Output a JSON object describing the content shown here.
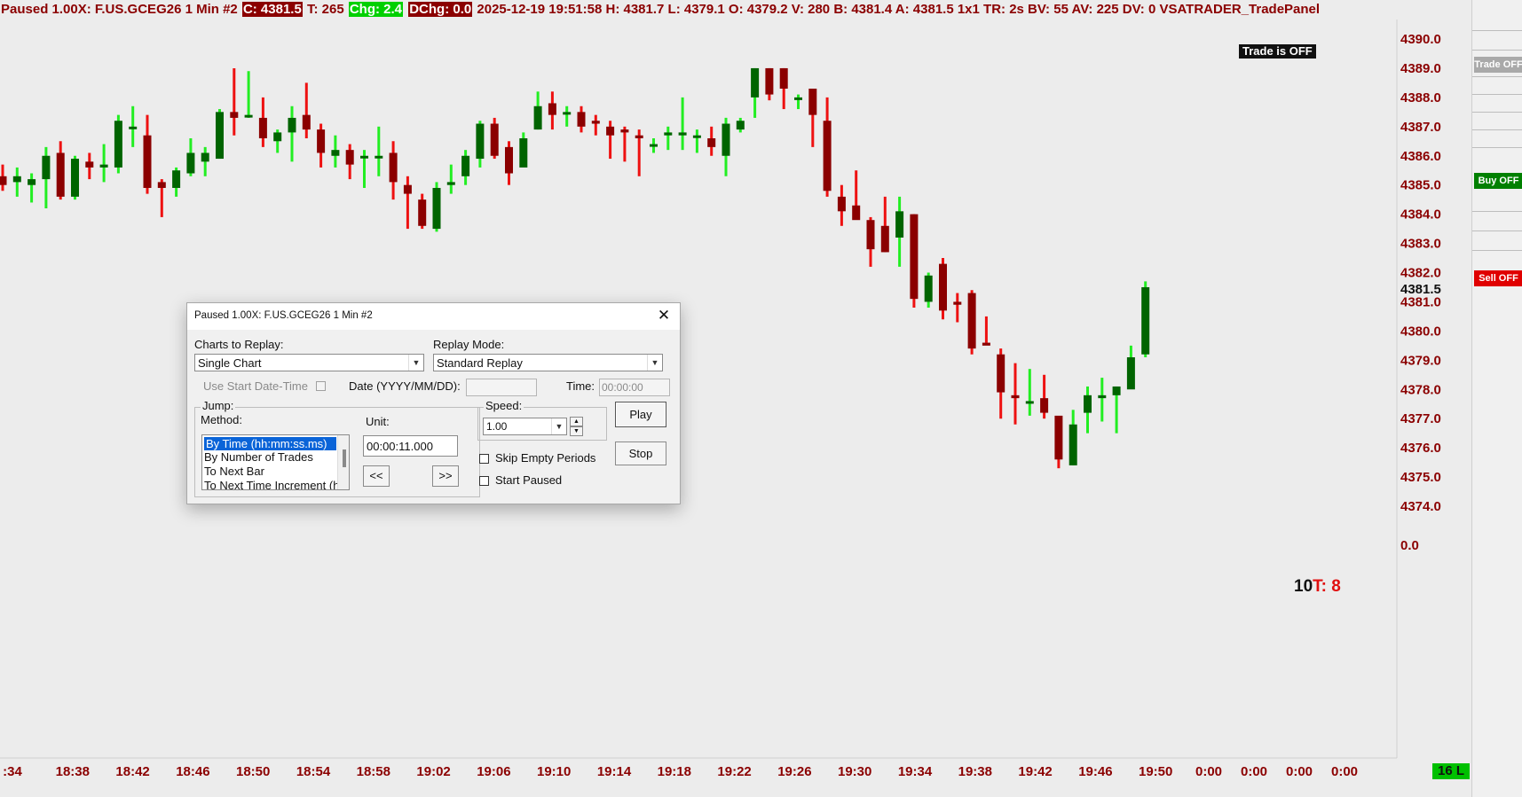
{
  "header": {
    "segments": [
      {
        "text": "Paused 1.00X: F.US.GCEG26  1 Min  #2 ",
        "style": "plain"
      },
      {
        "text": "C: 4381.5",
        "style": "dark"
      },
      {
        "text": " T: 265 ",
        "style": "plain"
      },
      {
        "text": "Chg: 2.4",
        "style": "green"
      },
      {
        "text": " ",
        "style": "plain"
      },
      {
        "text": "DChg: 0.0",
        "style": "dark"
      },
      {
        "text": " 2025-12-19 19:51:58 H: 4381.7 L: 4379.1 O: 4379.2 V: 280 B: 4381.4 A: 4381.5 1x1 TR: 2s BV: 55 AV: 225 DV: 0 VSATRADER_TradePanel",
        "style": "plain"
      }
    ]
  },
  "trade_off_label": "Trade is OFF",
  "right_panel": {
    "trade_off": "Trade OFF",
    "buy_off": "Buy OFF",
    "sell_off": "Sell OFF",
    "colors": {
      "trade": "#a9a9a9",
      "buy": "#008000",
      "sell": "#e00000"
    }
  },
  "bar_timer": {
    "part1": "10",
    "part2": "T: 8"
  },
  "bottom_badge": "16 L",
  "chart_data": {
    "type": "candlestick",
    "price_axis": {
      "labels": [
        "4390.0",
        "4389.0",
        "4388.0",
        "4387.0",
        "4386.0",
        "4385.0",
        "4384.0",
        "4383.0",
        "4382.0",
        "4381.0",
        "4380.0",
        "4379.0",
        "4378.0",
        "4377.0",
        "4376.0",
        "4375.0",
        "4374.0"
      ],
      "current_price": "4381.5",
      "extra_label": "0.0",
      "range": [
        4374.0,
        4390.0
      ]
    },
    "time_axis": {
      "labels": [
        ":34",
        "18:38",
        "18:42",
        "18:46",
        "18:50",
        "18:54",
        "18:58",
        "19:02",
        "19:06",
        "19:10",
        "19:14",
        "19:18",
        "19:22",
        "19:26",
        "19:30",
        "19:34",
        "19:38",
        "19:42",
        "19:46",
        "19:50",
        "0:00",
        "0:00",
        "0:00",
        "0:00"
      ]
    },
    "colors": {
      "up": "#00c800",
      "down": "#d40000",
      "up_body": "#006400",
      "down_body": "#8b0000",
      "up_wick": "#22ee22",
      "down_wick": "#ee1111"
    },
    "candles": [
      {
        "o": 4385.3,
        "h": 4385.7,
        "l": 4384.8,
        "c": 4385.0
      },
      {
        "o": 4385.1,
        "h": 4385.6,
        "l": 4384.6,
        "c": 4385.3
      },
      {
        "o": 4385.0,
        "h": 4385.4,
        "l": 4384.4,
        "c": 4385.2
      },
      {
        "o": 4385.2,
        "h": 4386.3,
        "l": 4384.2,
        "c": 4386.0
      },
      {
        "o": 4386.1,
        "h": 4386.5,
        "l": 4384.5,
        "c": 4384.6
      },
      {
        "o": 4384.6,
        "h": 4386.0,
        "l": 4384.5,
        "c": 4385.9
      },
      {
        "o": 4385.8,
        "h": 4386.1,
        "l": 4385.2,
        "c": 4385.6
      },
      {
        "o": 4385.6,
        "h": 4386.4,
        "l": 4385.1,
        "c": 4385.7
      },
      {
        "o": 4385.6,
        "h": 4387.4,
        "l": 4385.4,
        "c": 4387.2
      },
      {
        "o": 4387.0,
        "h": 4387.7,
        "l": 4386.3,
        "c": 4387.0
      },
      {
        "o": 4386.7,
        "h": 4387.4,
        "l": 4384.7,
        "c": 4384.9
      },
      {
        "o": 4385.1,
        "h": 4385.2,
        "l": 4383.9,
        "c": 4384.9
      },
      {
        "o": 4384.9,
        "h": 4385.6,
        "l": 4384.6,
        "c": 4385.5
      },
      {
        "o": 4385.4,
        "h": 4386.6,
        "l": 4385.3,
        "c": 4386.1
      },
      {
        "o": 4385.8,
        "h": 4386.3,
        "l": 4385.3,
        "c": 4386.1
      },
      {
        "o": 4385.9,
        "h": 4387.6,
        "l": 4385.9,
        "c": 4387.5
      },
      {
        "o": 4387.5,
        "h": 4389.0,
        "l": 4386.7,
        "c": 4387.3
      },
      {
        "o": 4387.4,
        "h": 4388.9,
        "l": 4387.3,
        "c": 4387.4
      },
      {
        "o": 4387.3,
        "h": 4388.0,
        "l": 4386.3,
        "c": 4386.6
      },
      {
        "o": 4386.5,
        "h": 4386.9,
        "l": 4386.1,
        "c": 4386.8
      },
      {
        "o": 4386.8,
        "h": 4387.7,
        "l": 4385.8,
        "c": 4387.3
      },
      {
        "o": 4387.4,
        "h": 4388.5,
        "l": 4386.6,
        "c": 4386.9
      },
      {
        "o": 4386.9,
        "h": 4387.1,
        "l": 4385.6,
        "c": 4386.1
      },
      {
        "o": 4386.0,
        "h": 4386.7,
        "l": 4385.6,
        "c": 4386.2
      },
      {
        "o": 4386.2,
        "h": 4386.4,
        "l": 4385.2,
        "c": 4385.7
      },
      {
        "o": 4386.0,
        "h": 4386.2,
        "l": 4384.9,
        "c": 4386.0
      },
      {
        "o": 4386.0,
        "h": 4387.0,
        "l": 4385.3,
        "c": 4386.0
      },
      {
        "o": 4386.1,
        "h": 4386.5,
        "l": 4384.5,
        "c": 4385.1
      },
      {
        "o": 4385.0,
        "h": 4385.3,
        "l": 4383.5,
        "c": 4384.7
      },
      {
        "o": 4384.5,
        "h": 4384.7,
        "l": 4383.5,
        "c": 4383.6
      },
      {
        "o": 4383.5,
        "h": 4385.1,
        "l": 4383.4,
        "c": 4384.9
      },
      {
        "o": 4385.0,
        "h": 4385.7,
        "l": 4384.7,
        "c": 4385.1
      },
      {
        "o": 4385.3,
        "h": 4386.2,
        "l": 4385.0,
        "c": 4386.0
      },
      {
        "o": 4385.9,
        "h": 4387.2,
        "l": 4385.6,
        "c": 4387.1
      },
      {
        "o": 4387.1,
        "h": 4387.3,
        "l": 4385.9,
        "c": 4386.0
      },
      {
        "o": 4386.3,
        "h": 4386.5,
        "l": 4385.0,
        "c": 4385.4
      },
      {
        "o": 4385.6,
        "h": 4386.8,
        "l": 4385.7,
        "c": 4386.6
      },
      {
        "o": 4386.9,
        "h": 4388.2,
        "l": 4386.9,
        "c": 4387.7
      },
      {
        "o": 4387.8,
        "h": 4388.2,
        "l": 4386.9,
        "c": 4387.4
      },
      {
        "o": 4387.5,
        "h": 4387.7,
        "l": 4387.0,
        "c": 4387.5
      },
      {
        "o": 4387.5,
        "h": 4387.7,
        "l": 4386.8,
        "c": 4387.0
      },
      {
        "o": 4387.2,
        "h": 4387.4,
        "l": 4386.7,
        "c": 4387.1
      },
      {
        "o": 4387.0,
        "h": 4387.2,
        "l": 4385.9,
        "c": 4386.7
      },
      {
        "o": 4386.9,
        "h": 4387.0,
        "l": 4385.8,
        "c": 4386.8
      },
      {
        "o": 4386.7,
        "h": 4386.9,
        "l": 4385.3,
        "c": 4386.6
      },
      {
        "o": 4386.4,
        "h": 4386.6,
        "l": 4386.1,
        "c": 4386.4
      },
      {
        "o": 4386.7,
        "h": 4387.0,
        "l": 4386.2,
        "c": 4386.8
      },
      {
        "o": 4386.7,
        "h": 4388.0,
        "l": 4386.2,
        "c": 4386.8
      },
      {
        "o": 4386.7,
        "h": 4386.9,
        "l": 4386.1,
        "c": 4386.7
      },
      {
        "o": 4386.6,
        "h": 4387.0,
        "l": 4386.0,
        "c": 4386.3
      },
      {
        "o": 4386.0,
        "h": 4387.3,
        "l": 4385.3,
        "c": 4387.1
      },
      {
        "o": 4386.9,
        "h": 4387.3,
        "l": 4386.8,
        "c": 4387.2
      },
      {
        "o": 4388.0,
        "h": 4389.0,
        "l": 4387.3,
        "c": 4389.0
      },
      {
        "o": 4389.0,
        "h": 4389.0,
        "l": 4387.9,
        "c": 4388.1
      },
      {
        "o": 4389.0,
        "h": 4389.0,
        "l": 4387.6,
        "c": 4388.3
      },
      {
        "o": 4388.0,
        "h": 4388.1,
        "l": 4387.6,
        "c": 4388.0
      },
      {
        "o": 4388.3,
        "h": 4388.3,
        "l": 4386.3,
        "c": 4387.4
      },
      {
        "o": 4387.2,
        "h": 4388.0,
        "l": 4384.6,
        "c": 4384.8
      },
      {
        "o": 4384.6,
        "h": 4385.0,
        "l": 4383.6,
        "c": 4384.1
      },
      {
        "o": 4384.3,
        "h": 4385.5,
        "l": 4383.9,
        "c": 4383.8
      },
      {
        "o": 4383.8,
        "h": 4383.9,
        "l": 4382.2,
        "c": 4382.8
      },
      {
        "o": 4383.6,
        "h": 4384.6,
        "l": 4382.7,
        "c": 4382.7
      },
      {
        "o": 4383.2,
        "h": 4384.6,
        "l": 4382.2,
        "c": 4384.1
      },
      {
        "o": 4384.0,
        "h": 4384.0,
        "l": 4380.8,
        "c": 4381.1
      },
      {
        "o": 4381.0,
        "h": 4382.0,
        "l": 4380.8,
        "c": 4381.9
      },
      {
        "o": 4382.3,
        "h": 4382.5,
        "l": 4380.4,
        "c": 4380.7
      },
      {
        "o": 4381.0,
        "h": 4381.3,
        "l": 4380.3,
        "c": 4380.9
      },
      {
        "o": 4381.3,
        "h": 4381.4,
        "l": 4379.2,
        "c": 4379.4
      },
      {
        "o": 4379.6,
        "h": 4380.5,
        "l": 4379.6,
        "c": 4379.5
      },
      {
        "o": 4379.2,
        "h": 4379.4,
        "l": 4377.0,
        "c": 4377.9
      },
      {
        "o": 4377.8,
        "h": 4378.9,
        "l": 4376.8,
        "c": 4377.7
      },
      {
        "o": 4377.6,
        "h": 4378.7,
        "l": 4377.1,
        "c": 4377.6
      },
      {
        "o": 4377.7,
        "h": 4378.5,
        "l": 4377.0,
        "c": 4377.2
      },
      {
        "o": 4377.1,
        "h": 4377.0,
        "l": 4375.3,
        "c": 4375.6
      },
      {
        "o": 4375.4,
        "h": 4377.3,
        "l": 4375.4,
        "c": 4376.8
      },
      {
        "o": 4377.2,
        "h": 4378.1,
        "l": 4376.5,
        "c": 4377.8
      },
      {
        "o": 4377.7,
        "h": 4378.4,
        "l": 4376.9,
        "c": 4377.8
      },
      {
        "o": 4377.8,
        "h": 4378.1,
        "l": 4376.5,
        "c": 4378.1
      },
      {
        "o": 4378.0,
        "h": 4379.5,
        "l": 4378.1,
        "c": 4379.1
      },
      {
        "o": 4379.2,
        "h": 4381.7,
        "l": 4379.1,
        "c": 4381.5
      }
    ]
  },
  "dialog": {
    "title": "Paused 1.00X: F.US.GCEG26  1 Min  #2",
    "charts_to_replay_label": "Charts to Replay:",
    "charts_to_replay_value": "Single Chart",
    "replay_mode_label": "Replay Mode:",
    "replay_mode_value": "Standard Replay",
    "use_start_label": "Use Start Date-Time",
    "date_label": "Date (YYYY/MM/DD):",
    "date_value": "",
    "time_label": "Time:",
    "time_value": "00:00:00",
    "jump_label": "Jump:",
    "method_label": "Method:",
    "methods": [
      "By Time (hh:mm:ss.ms)",
      "By Number of Trades",
      "To Next Bar",
      "To Next Time Increment (h"
    ],
    "unit_label": "Unit:",
    "unit_value": "00:00:11.000",
    "back_button": "<<",
    "forward_button": ">>",
    "speed_label": "Speed:",
    "speed_value": "1.00",
    "skip_empty_label": "Skip Empty Periods",
    "start_paused_label": "Start Paused",
    "play_button": "Play",
    "stop_button": "Stop"
  }
}
